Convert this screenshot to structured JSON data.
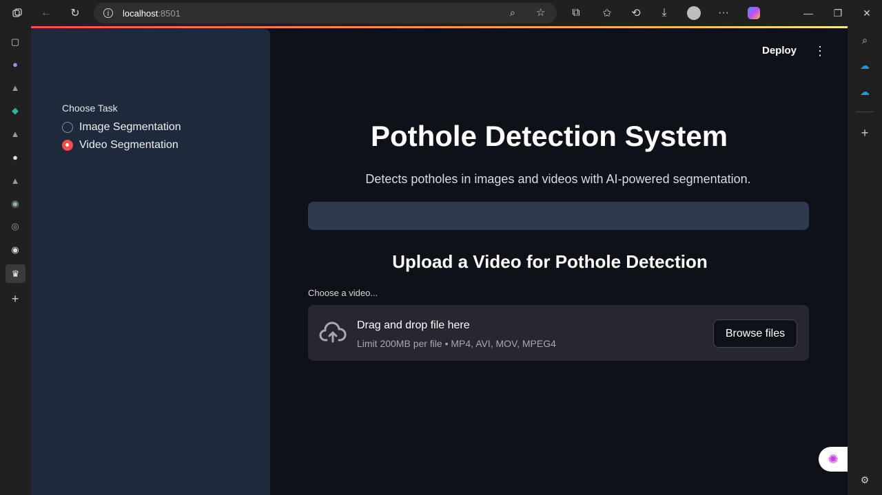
{
  "browser": {
    "url_host": "localhost",
    "url_port": ":8501"
  },
  "app": {
    "deploy_label": "Deploy",
    "menu_icon": "kebab-menu-icon"
  },
  "sidebar": {
    "radio_label": "Choose Task",
    "options": [
      {
        "label": "Image Segmentation",
        "checked": false
      },
      {
        "label": "Video Segmentation",
        "checked": true
      }
    ]
  },
  "main": {
    "title": "Pothole Detection System",
    "subtitle": "Detects potholes in images and videos with AI-powered segmentation.",
    "upload_heading": "Upload a Video for Pothole Detection",
    "uploader": {
      "label": "Choose a video...",
      "drop_text": "Drag and drop file here",
      "limit_text": "Limit 200MB per file • MP4, AVI, MOV, MPEG4",
      "browse_label": "Browse files"
    }
  },
  "colors": {
    "accent": "#ff4b4b",
    "sidebar_bg": "#1e293b",
    "page_bg": "#0e1117"
  }
}
